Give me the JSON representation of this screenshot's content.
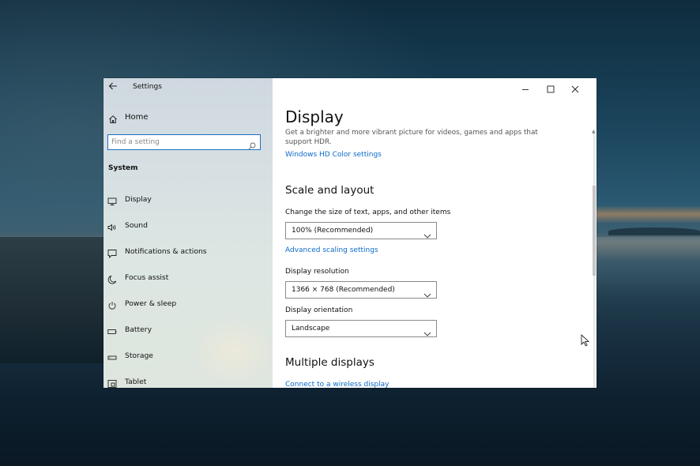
{
  "window": {
    "app_title": "Settings",
    "back_icon": "back-arrow-icon",
    "controls": {
      "minimize": "minimize-icon",
      "maximize": "maximize-icon",
      "close": "close-icon"
    }
  },
  "sidebar": {
    "home_label": "Home",
    "search_placeholder": "Find a setting",
    "section_title": "System",
    "items": [
      {
        "label": "Display",
        "icon": "monitor-icon"
      },
      {
        "label": "Sound",
        "icon": "speaker-icon"
      },
      {
        "label": "Notifications & actions",
        "icon": "notification-icon"
      },
      {
        "label": "Focus assist",
        "icon": "moon-icon"
      },
      {
        "label": "Power & sleep",
        "icon": "power-icon"
      },
      {
        "label": "Battery",
        "icon": "battery-icon"
      },
      {
        "label": "Storage",
        "icon": "storage-icon"
      },
      {
        "label": "Tablet",
        "icon": "tablet-icon"
      }
    ]
  },
  "main": {
    "title": "Display",
    "hdr_desc_line1": "Get a brighter and more vibrant picture for videos, games and apps that",
    "hdr_desc_line2": "support HDR.",
    "hdr_link": "Windows HD Color settings",
    "scale_section": "Scale and layout",
    "scale_label": "Change the size of text, apps, and other items",
    "scale_value": "100% (Recommended)",
    "advanced_link": "Advanced scaling settings",
    "resolution_label": "Display resolution",
    "resolution_value": "1366 × 768 (Recommended)",
    "orientation_label": "Display orientation",
    "orientation_value": "Landscape",
    "multi_section": "Multiple displays",
    "wireless_link": "Connect to a wireless display"
  },
  "colors": {
    "accent": "#0b6ac8",
    "search_border": "#1f6fc5"
  }
}
